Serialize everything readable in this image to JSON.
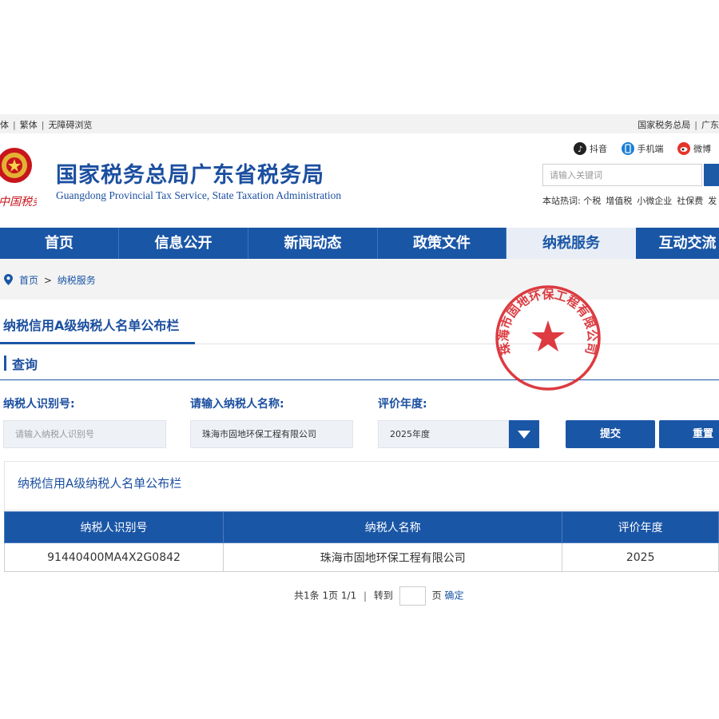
{
  "topbar": {
    "left": [
      "体",
      "繁体",
      "无障碍浏览"
    ],
    "right": [
      "国家税务总局",
      "广东"
    ]
  },
  "header": {
    "logo_text": "中国税务",
    "title_cn": "国家税务总局广东省税务局",
    "title_en": "Guangdong Provincial Tax Service, State Taxation Administration",
    "socials": [
      {
        "icon": "douyin-icon",
        "label": "抖音"
      },
      {
        "icon": "mobile-icon",
        "label": "手机端"
      },
      {
        "icon": "weibo-icon",
        "label": "微博"
      }
    ],
    "search_placeholder": "请输入关键词",
    "hot_label": "本站热词:",
    "hot_words": [
      "个税",
      "增值税",
      "小微企业",
      "社保费",
      "发"
    ]
  },
  "nav": {
    "items": [
      "首页",
      "信息公开",
      "新闻动态",
      "政策文件",
      "纳税服务",
      "互动交流"
    ],
    "active_index": 4
  },
  "breadcrumb": {
    "home": "首页",
    "separator": ">",
    "current": "纳税服务"
  },
  "section_title": "纳税信用A级纳税人名单公布栏",
  "query": {
    "title": "查询",
    "id_label": "纳税人识别号:",
    "id_placeholder": "请输入纳税人识别号",
    "name_label": "请输入纳税人名称:",
    "name_value": "珠海市固地环保工程有限公司",
    "year_label": "评价年度:",
    "year_value": "2025年度",
    "submit_label": "提交",
    "reset_label": "重置"
  },
  "results": {
    "panel_title": "纳税信用A级纳税人名单公布栏",
    "columns": [
      "纳税人识别号",
      "纳税人名称",
      "评价年度"
    ],
    "rows": [
      [
        "91440400MA4X2G0842",
        "珠海市固地环保工程有限公司",
        "2025"
      ]
    ]
  },
  "pager": {
    "summary": "共1条 1页 1/1",
    "goto_label": "转到",
    "page_label": "页",
    "confirm_label": "确定"
  },
  "stamp": {
    "text": "珠海市固地环保工程有限公司"
  },
  "colors": {
    "primary": "#1a56a6",
    "title_blue": "#1c4fa0",
    "stamp_red": "#d9262c"
  }
}
